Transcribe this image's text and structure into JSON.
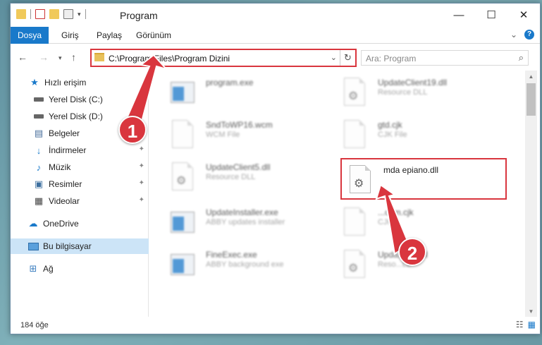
{
  "window": {
    "title": "Program"
  },
  "ribbon": {
    "tabs": [
      "Dosya",
      "Giriş",
      "Paylaş",
      "Görünüm"
    ],
    "active_tab": "Dosya"
  },
  "address": {
    "path": "C:\\Program Files\\Program Dizini"
  },
  "search": {
    "placeholder": "Ara: Program"
  },
  "sidebar": {
    "items": [
      {
        "label": "Hızlı erişim",
        "icon": "star-icon"
      },
      {
        "label": "Yerel Disk (C:)",
        "icon": "drive-icon"
      },
      {
        "label": "Yerel Disk (D:)",
        "icon": "drive-icon"
      },
      {
        "label": "Belgeler",
        "icon": "documents-icon"
      },
      {
        "label": "İndirmeler",
        "icon": "download-icon"
      },
      {
        "label": "Müzik",
        "icon": "music-icon"
      },
      {
        "label": "Resimler",
        "icon": "pictures-icon"
      },
      {
        "label": "Videolar",
        "icon": "videos-icon"
      },
      {
        "label": "OneDrive",
        "icon": "cloud-icon"
      },
      {
        "label": "Bu bilgisayar",
        "icon": "computer-icon"
      },
      {
        "label": "Ağ",
        "icon": "network-icon"
      }
    ]
  },
  "files": [
    {
      "name": "program.exe",
      "type": "",
      "icon": "exe-icon"
    },
    {
      "name": "UpdateClient19.dll",
      "type": "Resource DLL",
      "icon": "dll-icon"
    },
    {
      "name": "SndToWP16.wcm",
      "type": "WCM File",
      "icon": "file-icon"
    },
    {
      "name": "gtd.cjk",
      "type": "CJK File",
      "icon": "file-icon"
    },
    {
      "name": "UpdateClient5.dll",
      "type": "Resource DLL",
      "icon": "dll-icon"
    },
    {
      "name": "mda epiano.dll",
      "type": "",
      "icon": "dll-icon"
    },
    {
      "name": "UpdateInstaller.exe",
      "type": "ABBY updates installer",
      "icon": "app-icon"
    },
    {
      "name": "...com.cjk",
      "type": "CJK...",
      "icon": "file-icon"
    },
    {
      "name": "FineExec.exe",
      "type": "ABBY background exe",
      "icon": "app-icon"
    },
    {
      "name": "Upda...t65.dll",
      "type": "Reso...LL",
      "icon": "dll-icon"
    }
  ],
  "status": {
    "count": "184 öğe"
  },
  "callouts": [
    "1",
    "2"
  ],
  "colors": {
    "accent": "#1979ca",
    "highlight_red": "#d9363e",
    "selected": "#cce4f7"
  }
}
